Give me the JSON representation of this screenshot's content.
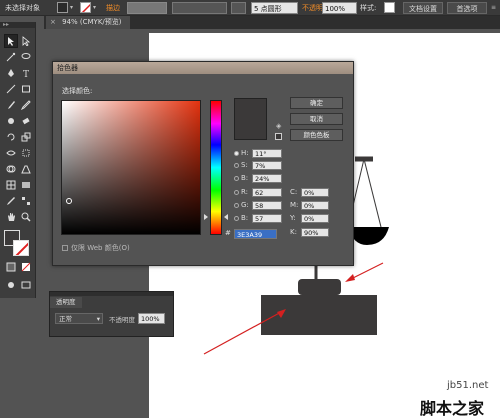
{
  "control_bar": {
    "selection_status": "未选择对象",
    "stroke_label": "描边",
    "stroke_weight_value": "",
    "brush_size": "5 点圆形",
    "opacity_label": "不透明度",
    "opacity_value": "100%",
    "style_label": "样式:",
    "doc_setup_button": "文档设置",
    "preferences_button": "首选项"
  },
  "document": {
    "tab_title": "94% (CMYK/预览)",
    "close_symbol": "×"
  },
  "color_picker": {
    "title": "拾色器",
    "select_color_label": "选择颜色:",
    "ok_button": "确定",
    "cancel_button": "取消",
    "swatches_button": "颜色色板",
    "fields": [
      {
        "label": "H:",
        "value": "11°",
        "selected": true
      },
      {
        "label": "S:",
        "value": "7%",
        "selected": false
      },
      {
        "label": "B:",
        "value": "24%",
        "selected": false
      },
      {
        "label": "R:",
        "value": "62",
        "selected": false
      },
      {
        "label": "G:",
        "value": "58",
        "selected": false
      },
      {
        "label": "B:",
        "value": "57",
        "selected": false
      }
    ],
    "cmyk": [
      {
        "label": "C:",
        "value": "0%"
      },
      {
        "label": "M:",
        "value": "0%"
      },
      {
        "label": "Y:",
        "value": "0%"
      },
      {
        "label": "K:",
        "value": "90%"
      }
    ],
    "hex_label": "#",
    "hex_value": "3E3A39",
    "web_only_label": "仅限 Web 颜色(O)",
    "current_color": "#3b3939"
  },
  "transparency_panel": {
    "tab_label": "透明度",
    "blend_mode": "正常",
    "opacity_label": "不透明度",
    "opacity_value": "100%"
  },
  "watermark": {
    "line1": "jb51.net",
    "line2": "脚本之家"
  },
  "colors": {
    "annotation_arrow": "#d42020",
    "shape_fill": "#3b3939",
    "accent_orange": "#f08c28"
  }
}
